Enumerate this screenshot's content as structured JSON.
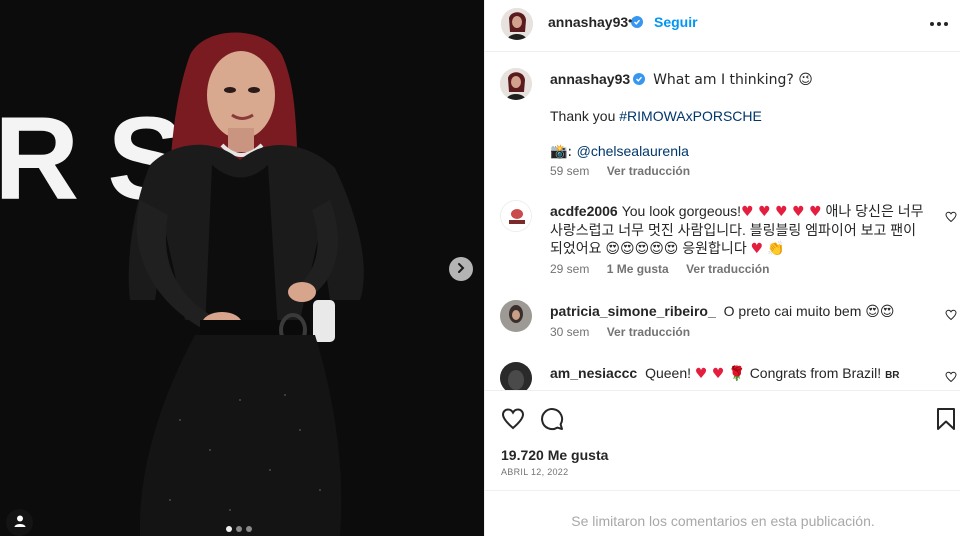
{
  "media": {
    "backdrop_text": "RSC",
    "carousel_count": 3,
    "carousel_active_index": 0,
    "next_icon": "chevron-right-icon",
    "tag_icon": "user-tag-icon"
  },
  "header": {
    "username": "annashay93",
    "separator": "•",
    "follow_label": "Seguir",
    "more_icon": "more-horizontal-icon"
  },
  "caption": {
    "username": "annashay93",
    "line1": "What am I thinking? 😉",
    "line2_prefix": "Thank you ",
    "hashtag": "#RIMOWAxPORSCHE",
    "credit_prefix": "📸: ",
    "mention": "@chelsealaurenla",
    "time": "59 sem",
    "translate": "Ver traducción"
  },
  "comments": [
    {
      "username": "acdfe2006",
      "text_part1": "You look gorgeous!",
      "hearts1": "♥ ♥ ♥ ♥ ♥",
      "text_part2": "애나 당신은 너무 사랑스럽고 너무 멋진 사람입니다. 블링블링 엠파이어 보고 팬이 되었어요",
      "faces": "😍😍😍😍😍",
      "text_part3": "응원합니다",
      "tail": "♥",
      "clap": "👏",
      "time": "29 sem",
      "likes": "1 Me gusta",
      "translate": "Ver traducción"
    },
    {
      "username": "patricia_simone_ribeiro_",
      "text_part1": "O preto cai muito bem",
      "faces": "😍😍",
      "time": "30 sem",
      "translate": "Ver traducción"
    },
    {
      "username": "am_nesiaccc",
      "text_part1": "Queen!",
      "hearts1": "♥  ♥",
      "rose": "🌹",
      "text_part2": "Congrats from Brazil!",
      "flag": "BR"
    }
  ],
  "actions": {
    "like_icon": "heart-outline-icon",
    "comment_icon": "comment-icon",
    "save_icon": "bookmark-icon",
    "likes_text": "19.720 Me gusta",
    "date": "Abril 12, 2022"
  },
  "footer": {
    "notice": "Se limitaron los comentarios en esta publicación."
  },
  "colors": {
    "accent": "#0095f6",
    "verified": "#3797f0",
    "heart": "#e41e3f",
    "muted": "#737373"
  }
}
